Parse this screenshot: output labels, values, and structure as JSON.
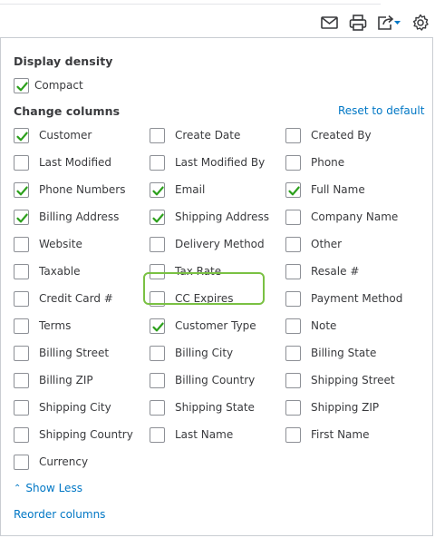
{
  "colors": {
    "accent": "#0077c5",
    "check": "#2ca01c",
    "highlight": "#7ac143"
  },
  "toolbar": {
    "icons": [
      "email-icon",
      "print-icon",
      "export-icon",
      "settings-gear-icon"
    ]
  },
  "display_density": {
    "title": "Display density",
    "compact": {
      "label": "Compact",
      "checked": true
    }
  },
  "change_columns": {
    "title": "Change columns",
    "reset_label": "Reset to default",
    "columns": [
      [
        {
          "label": "Customer",
          "checked": true
        },
        {
          "label": "Last Modified",
          "checked": false
        },
        {
          "label": "Phone Numbers",
          "checked": true
        },
        {
          "label": "Billing Address",
          "checked": true
        },
        {
          "label": "Website",
          "checked": false
        },
        {
          "label": "Taxable",
          "checked": false
        },
        {
          "label": "Credit Card #",
          "checked": false
        },
        {
          "label": "Terms",
          "checked": false
        },
        {
          "label": "Billing Street",
          "checked": false
        },
        {
          "label": "Billing ZIP",
          "checked": false
        },
        {
          "label": "Shipping City",
          "checked": false
        },
        {
          "label": "Shipping Country",
          "checked": false
        },
        {
          "label": "Currency",
          "checked": false
        }
      ],
      [
        {
          "label": "Create Date",
          "checked": false
        },
        {
          "label": "Last Modified By",
          "checked": false
        },
        {
          "label": "Email",
          "checked": true
        },
        {
          "label": "Shipping Address",
          "checked": true
        },
        {
          "label": "Delivery Method",
          "checked": false
        },
        {
          "label": "Tax Rate",
          "checked": false
        },
        {
          "label": "CC Expires",
          "checked": false
        },
        {
          "label": "Customer Type",
          "checked": true
        },
        {
          "label": "Billing City",
          "checked": false
        },
        {
          "label": "Billing Country",
          "checked": false
        },
        {
          "label": "Shipping State",
          "checked": false
        },
        {
          "label": "Last Name",
          "checked": false
        }
      ],
      [
        {
          "label": "Created By",
          "checked": false
        },
        {
          "label": "Phone",
          "checked": false
        },
        {
          "label": "Full Name",
          "checked": true
        },
        {
          "label": "Company Name",
          "checked": false
        },
        {
          "label": "Other",
          "checked": false
        },
        {
          "label": "Resale #",
          "checked": false
        },
        {
          "label": "Payment Method",
          "checked": false
        },
        {
          "label": "Note",
          "checked": false
        },
        {
          "label": "Billing State",
          "checked": false
        },
        {
          "label": "Shipping Street",
          "checked": false
        },
        {
          "label": "Shipping ZIP",
          "checked": false
        },
        {
          "label": "First Name",
          "checked": false
        }
      ]
    ],
    "show_less_label": "Show Less",
    "reorder_label": "Reorder columns"
  }
}
